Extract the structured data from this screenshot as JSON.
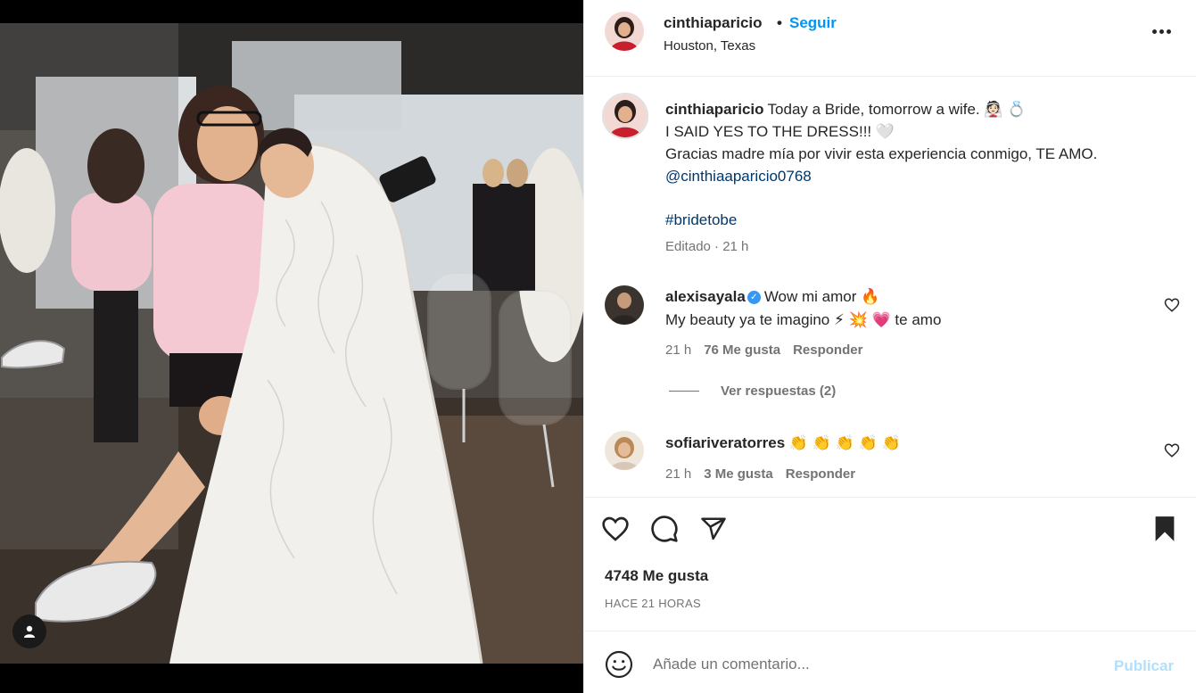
{
  "post": {
    "author": "cinthiaparicio",
    "separator": "•",
    "follow_label": "Seguir",
    "location": "Houston, Texas"
  },
  "caption": {
    "username": "cinthiaparicio",
    "line1": "Today a Bride, tomorrow a wife. 👰🏻 💍",
    "line2": "I SAID YES TO THE DRESS!!! 🤍",
    "line3": "Gracias madre mía por vivir esta experiencia conmigo, TE AMO.",
    "mention": "@cinthiaaparicio0768",
    "hashtag": "#bridetobe",
    "meta": "Editado · 21 h"
  },
  "comments": [
    {
      "username": "alexisayala",
      "verified": "✓",
      "line1": "Wow mi amor 🔥",
      "line2": "My beauty ya te imagino ⚡ 💥 💗 te amo",
      "time": "21 h",
      "likes": "76 Me gusta",
      "reply": "Responder"
    },
    {
      "username": "sofiariveratorres",
      "line1": "👏 👏 👏 👏 👏",
      "time": "21 h",
      "likes": "3 Me gusta",
      "reply": "Responder"
    }
  ],
  "view_replies": "Ver respuestas (2)",
  "likes_count": "4748 Me gusta",
  "time_ago": "HACE 21 HORAS",
  "add_comment": {
    "placeholder": "Añade un comentario...",
    "publish_label": "Publicar"
  },
  "colors": {
    "link": "#0095f6",
    "publish_disabled": "#b2dffc",
    "verified": "#3897f0"
  }
}
